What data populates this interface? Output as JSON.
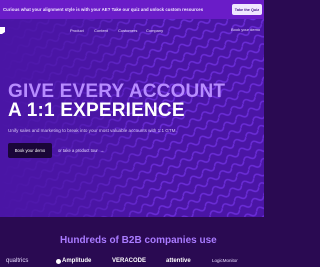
{
  "announcement": {
    "text": "Curious what your alignment style is with your AE? Take our quiz and unlock custom resources",
    "button": "Take the Quiz"
  },
  "nav": {
    "items": [
      "Product",
      "Content",
      "Customers",
      "Company"
    ],
    "cta": "Book your demo"
  },
  "hero": {
    "headline_line1": "GIVE EVERY ACCOUNT",
    "headline_line2": "A 1:1 EXPERIENCE",
    "subtitle": "Unify sales and marketing to break into your most valuable accounts with 1:1 GTM.",
    "primary_cta": "Book your demo",
    "secondary_cta": "or take a product tour",
    "secondary_arrow": "→"
  },
  "logos": {
    "title": "Hundreds of B2B companies use",
    "items": [
      {
        "name": "qualtrics",
        "icon": "qualtrics-logo"
      },
      {
        "name": "Amplitude",
        "icon": "amplitude-logo"
      },
      {
        "name": "VERACODE",
        "icon": "veracode-logo"
      },
      {
        "name": "attentive",
        "icon": "attentive-logo"
      },
      {
        "name": "LogicMonitor",
        "icon": "logicmonitor-logo"
      }
    ]
  },
  "colors": {
    "announcement_bg": "#6a1cc8",
    "hero_bg": "#4a15a5",
    "accent": "#b88cff",
    "page_bg": "#2a0a52"
  }
}
